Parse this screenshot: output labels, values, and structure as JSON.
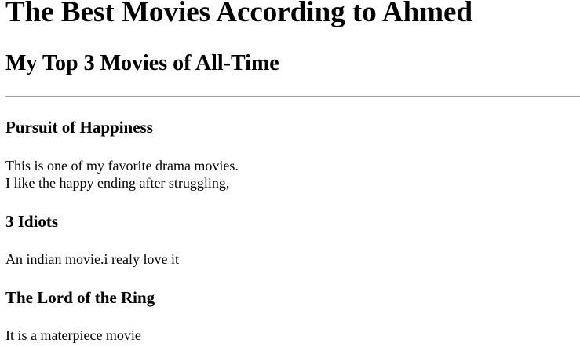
{
  "page": {
    "title": "The Best Movies According to Ahmed",
    "subtitle": "My Top 3 Movies of All-Time"
  },
  "movies": [
    {
      "title": "Pursuit of Happiness",
      "lines": [
        "This is one of my favorite drama movies.",
        "I like the happy ending after struggling,"
      ]
    },
    {
      "title": "3 Idiots",
      "lines": [
        "An indian movie.i realy love it"
      ]
    },
    {
      "title": "The Lord of the Ring",
      "lines": [
        "It is a materpiece movie"
      ]
    }
  ]
}
